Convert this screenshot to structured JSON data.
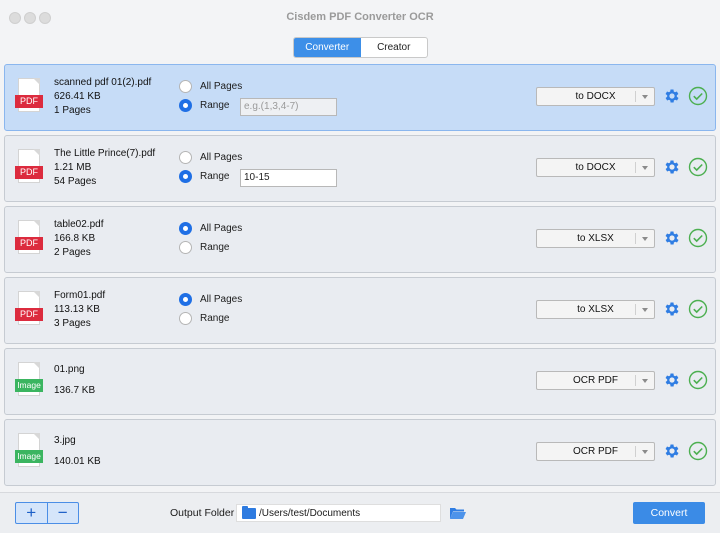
{
  "window": {
    "title": "Cisdem PDF Converter OCR"
  },
  "tabs": [
    {
      "label": "Converter",
      "active": true
    },
    {
      "label": "Creator",
      "active": false
    }
  ],
  "files": [
    {
      "name": "scanned pdf 01(2).pdf",
      "size": "626.41 KB",
      "pages": "1 Pages",
      "type": "PDF",
      "all_label": "All Pages",
      "range_label": "Range",
      "range_value": "",
      "range_placeholder": "e.g.(1,3,4-7)",
      "mode": "range",
      "format": "to DOCX",
      "selected": true
    },
    {
      "name": "The Little Prince(7).pdf",
      "size": "1.21 MB",
      "pages": "54 Pages",
      "type": "PDF",
      "all_label": "All Pages",
      "range_label": "Range",
      "range_value": "10-15",
      "range_placeholder": "",
      "mode": "range",
      "format": "to DOCX",
      "selected": false
    },
    {
      "name": "table02.pdf",
      "size": "166.8 KB",
      "pages": "2 Pages",
      "type": "PDF",
      "all_label": "All Pages",
      "range_label": "Range",
      "mode": "all",
      "format": "to XLSX",
      "selected": false
    },
    {
      "name": "Form01.pdf",
      "size": "113.13 KB",
      "pages": "3 Pages",
      "type": "PDF",
      "all_label": "All Pages",
      "range_label": "Range",
      "mode": "all",
      "format": "to XLSX",
      "selected": false
    },
    {
      "name": "01.png",
      "size": "136.7 KB",
      "type": "Image",
      "format": "OCR PDF",
      "selected": false
    },
    {
      "name": "3.jpg",
      "size": "140.01 KB",
      "type": "Image",
      "format": "OCR PDF",
      "selected": false
    }
  ],
  "footer": {
    "add_label": "+",
    "remove_label": "−",
    "output_label": "Output Folder",
    "output_path": "/Users/test/Documents",
    "convert_label": "Convert"
  },
  "colors": {
    "accent": "#3b8be6",
    "pdf_tag": "#dc2b3e",
    "image_tag": "#3bb560",
    "done": "#4caf50"
  }
}
